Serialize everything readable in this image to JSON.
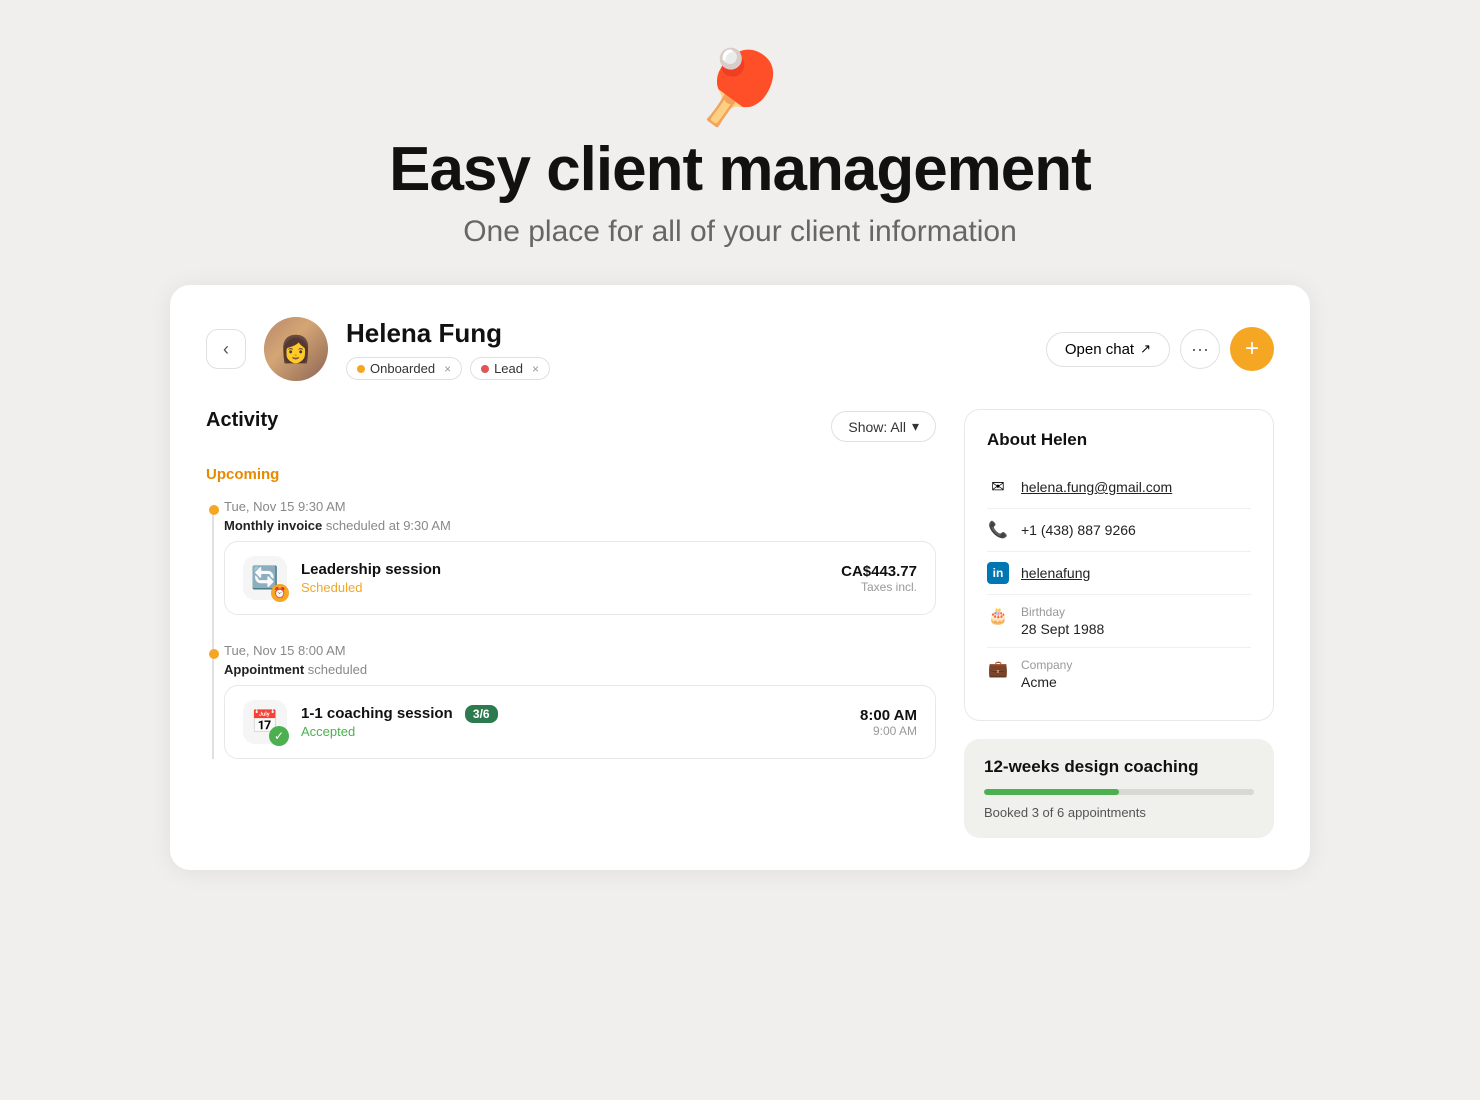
{
  "hero": {
    "icon": "🏓",
    "title": "Easy client management",
    "subtitle": "One place for all of your client information"
  },
  "header": {
    "client_name": "Helena Fung",
    "tags": [
      {
        "label": "Onboarded",
        "color": "orange"
      },
      {
        "label": "Lead",
        "color": "red"
      }
    ],
    "open_chat_label": "Open chat",
    "back_label": "‹",
    "more_label": "···",
    "add_label": "+"
  },
  "activity": {
    "title": "Activity",
    "show_filter_label": "Show: All",
    "upcoming_label": "Upcoming",
    "items": [
      {
        "date": "Tue, Nov 15 9:30 AM",
        "description_bold": "Monthly invoice",
        "description": " scheduled at 9:30 AM",
        "sessions": [
          {
            "icon": "🔄",
            "icon_badge": "clock",
            "name": "Leadership session",
            "status": "Scheduled",
            "status_type": "scheduled",
            "price": "CA$443.77",
            "price_sub": "Taxes incl.",
            "badge": null
          }
        ]
      },
      {
        "date": "Tue, Nov 15 8:00 AM",
        "description_bold": "Appointment",
        "description": " scheduled",
        "sessions": [
          {
            "icon": "📅",
            "icon_badge": "check",
            "name": "1-1 coaching session",
            "status": "Accepted",
            "status_type": "accepted",
            "time": "8:00 AM",
            "time_sub": "9:00 AM",
            "badge": "3/6"
          }
        ]
      }
    ]
  },
  "about": {
    "title": "About Helen",
    "email": "helena.fung@gmail.com",
    "phone": "+1 (438) 887 9266",
    "linkedin": "helenafung",
    "birthday_label": "Birthday",
    "birthday": "28 Sept 1988",
    "company_label": "Company",
    "company": "Acme"
  },
  "program": {
    "title": "12-weeks design coaching",
    "booked_label": "Booked 3 of 6 appointments",
    "progress_percent": 50
  }
}
